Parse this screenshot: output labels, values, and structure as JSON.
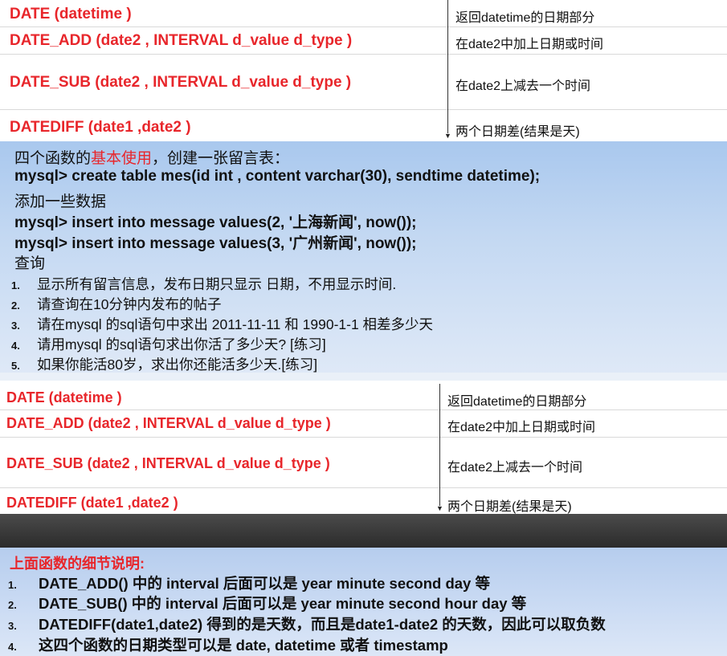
{
  "table_top": {
    "rows": [
      {
        "fn": "DATE (datetime )",
        "desc": "返回datetime的日期部分"
      },
      {
        "fn": "DATE_ADD (date2 , INTERVAL d_value d_type )",
        "desc": "在date2中加上日期或时间"
      },
      {
        "fn": "DATE_SUB (date2 , INTERVAL d_value d_type )",
        "desc": "在date2上减去一个时间"
      },
      {
        "fn": "DATEDIFF (date1 ,date2 )",
        "desc": "两个日期差(结果是天)"
      }
    ]
  },
  "panel1": {
    "intro_prefix": "四个函数的",
    "intro_red": "基本使用",
    "intro_suffix": "，创建一张留言表：",
    "sql_create": "mysql> create table mes(id int , content varchar(30), sendtime datetime);",
    "add_data": "添加一些数据",
    "sql_insert1": "mysql> insert into message values(2, '上海新闻', now());",
    "sql_insert2": "mysql> insert into message values(3, '广州新闻', now());",
    "query": "查询",
    "items": [
      {
        "num": "1.",
        "text": "显示所有留言信息，发布日期只显示 日期，不用显示时间."
      },
      {
        "num": "2.",
        "text": "请查询在10分钟内发布的帖子"
      },
      {
        "num": "3.",
        "text": "请在mysql 的sql语句中求出 2011-11-11 和 1990-1-1 相差多少天"
      },
      {
        "num": "4.",
        "text": "请用mysql 的sql语句求出你活了多少天? [练习]"
      },
      {
        "num": "5.",
        "text": "如果你能活80岁，求出你还能活多少天.[练习]"
      }
    ]
  },
  "table_bottom": {
    "rows": [
      {
        "fn": "DATE (datetime )",
        "desc": "返回datetime的日期部分"
      },
      {
        "fn": "DATE_ADD (date2 , INTERVAL d_value d_type )",
        "desc": "在date2中加上日期或时间"
      },
      {
        "fn": "DATE_SUB (date2 , INTERVAL d_value d_type )",
        "desc": "在date2上减去一个时间"
      },
      {
        "fn": "DATEDIFF (date1 ,date2 )",
        "desc": "两个日期差(结果是天)"
      }
    ]
  },
  "panel2": {
    "title": "上面函数的细节说明:",
    "items": [
      {
        "num": "1.",
        "text": "DATE_ADD() 中的  interval 后面可以是  year minute second day 等"
      },
      {
        "num": "2.",
        "text": "DATE_SUB() 中的  interval 后面可以是  year minute second hour day 等"
      },
      {
        "num": "3.",
        "text": "DATEDIFF(date1,date2) 得到的是天数，而且是date1-date2 的天数，因此可以取负数"
      },
      {
        "num": "4.",
        "text": "这四个函数的日期类型可以是 date, datetime 或者  timestamp"
      }
    ]
  },
  "colors": {
    "accent_red": "#e8262b",
    "panel_blue": "#b6cdee"
  }
}
